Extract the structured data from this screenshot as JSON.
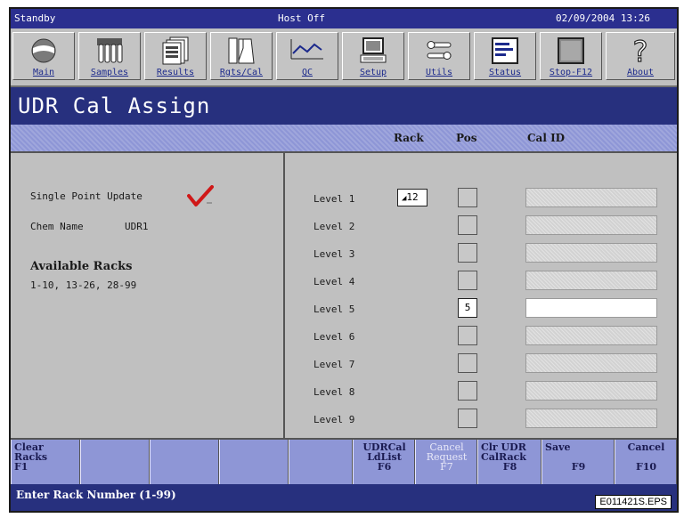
{
  "titlebar": {
    "left": "Standby",
    "center": "Host Off",
    "right": "02/09/2004 13:26"
  },
  "toolbar": [
    {
      "label": "Main",
      "icon": "main-icon"
    },
    {
      "label": "Samples",
      "icon": "samples-icon"
    },
    {
      "label": "Results",
      "icon": "results-icon"
    },
    {
      "label": "Rgts/Cal",
      "icon": "reagents-icon"
    },
    {
      "label": "QC",
      "icon": "qc-chart-icon"
    },
    {
      "label": "Setup",
      "icon": "computer-icon"
    },
    {
      "label": "Utils",
      "icon": "tools-icon"
    },
    {
      "label": "Status",
      "icon": "status-icon"
    },
    {
      "label": "Stop-F12",
      "icon": "stop-icon"
    },
    {
      "label": "About",
      "icon": "question-icon"
    }
  ],
  "screen": {
    "title": "UDR Cal Assign"
  },
  "columns": {
    "rack": "Rack",
    "pos": "Pos",
    "calid": "Cal ID"
  },
  "left": {
    "single_point_label": "Single Point Update",
    "single_point_checked": true,
    "chem_name_label": "Chem Name",
    "chem_name_value": "UDR1",
    "available_racks_title": "Available Racks",
    "available_racks_value": "1-10, 13-26, 28-99"
  },
  "levels": [
    {
      "label": "Level 1",
      "rack": "12",
      "pos": "",
      "calid": ""
    },
    {
      "label": "Level 2",
      "rack": "",
      "pos": "",
      "calid": ""
    },
    {
      "label": "Level 3",
      "rack": "",
      "pos": "",
      "calid": ""
    },
    {
      "label": "Level 4",
      "rack": "",
      "pos": "",
      "calid": ""
    },
    {
      "label": "Level 5",
      "rack": "",
      "pos": "5",
      "calid": ""
    },
    {
      "label": "Level 6",
      "rack": "",
      "pos": "",
      "calid": ""
    },
    {
      "label": "Level 7",
      "rack": "",
      "pos": "",
      "calid": ""
    },
    {
      "label": "Level 8",
      "rack": "",
      "pos": "",
      "calid": ""
    },
    {
      "label": "Level 9",
      "rack": "",
      "pos": "",
      "calid": ""
    }
  ],
  "fkeys": {
    "f1": {
      "l1": "Clear",
      "l2": "Racks",
      "l3": "F1"
    },
    "f6": {
      "l1": "UDRCal",
      "l2": "LdList",
      "l3": "F6"
    },
    "f7": {
      "l1": "Cancel",
      "l2": "Request",
      "l3": "F7"
    },
    "f8": {
      "l1": "Clr UDR",
      "l2": "CalRack",
      "l3": "F8"
    },
    "f9": {
      "l1": "Save",
      "l2": "",
      "l3": "F9"
    },
    "f10": {
      "l1": "Cancel",
      "l2": "",
      "l3": "F10"
    }
  },
  "status": {
    "message": "Enter Rack Number (1-99)",
    "figure_tag": "E011421S.EPS"
  },
  "colors": {
    "titlebar": "#2b2f8f",
    "header_band": "#8e96d6",
    "panel": "#c0c0c0",
    "check": "#d01818"
  }
}
